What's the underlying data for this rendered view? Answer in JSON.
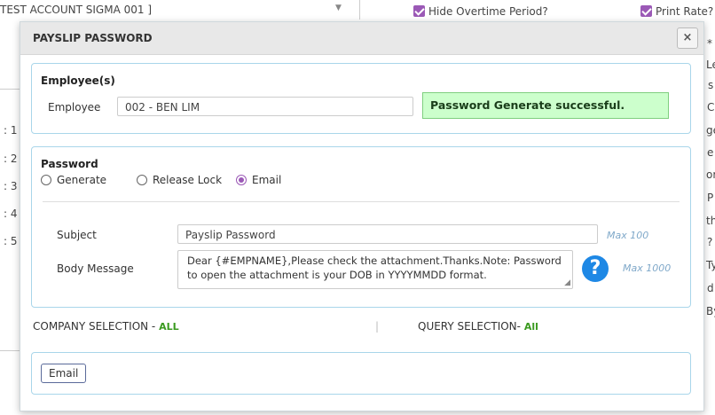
{
  "background": {
    "account_select_value": "TEST ACCOUNT SIGMA 001 ]",
    "hide_overtime_label": "Hide Overtime Period?",
    "print_rate_label": "Print Rate?",
    "left_numbers": [
      ": 1",
      ": 2",
      ": 3",
      ": 4",
      ": 5"
    ],
    "right_letters": [
      "*",
      "Le",
      "s",
      "C",
      "ge",
      "e",
      "or",
      "P",
      "th",
      "?",
      "Ty",
      "d",
      "By"
    ]
  },
  "modal": {
    "title": "PAYSLIP PASSWORD",
    "close_label": "×",
    "employees_section": {
      "heading": "Employee(s)",
      "employee_label": "Employee",
      "employee_value": "002 - BEN LIM",
      "success_message": "Password Generate successful."
    },
    "password_section": {
      "heading": "Password",
      "options": [
        {
          "label": "Generate",
          "selected": false
        },
        {
          "label": "Release Lock",
          "selected": false
        },
        {
          "label": "Email",
          "selected": true
        }
      ],
      "subject_label": "Subject",
      "subject_value": "Payslip Password",
      "subject_max": "Max 100",
      "body_label": "Body Message",
      "body_value": "Dear {#EMPNAME},Please check the attachment.Thanks.Note: Password to open the attachment is your DOB in YYYYMMDD format.",
      "body_max": "Max 1000",
      "help_icon": "?"
    },
    "selection": {
      "company_label": "COMPANY SELECTION - ",
      "company_value": "ALL",
      "divider": "|",
      "query_label": "QUERY SELECTION- ",
      "query_value": "All"
    },
    "footer": {
      "email_button": "Email"
    }
  },
  "colors": {
    "accent_purple": "#9b59b6",
    "panel_border": "#a9d6ea",
    "success_bg": "#ccffcc",
    "help_blue": "#1e88e5",
    "selection_green": "#3a9a1f"
  }
}
